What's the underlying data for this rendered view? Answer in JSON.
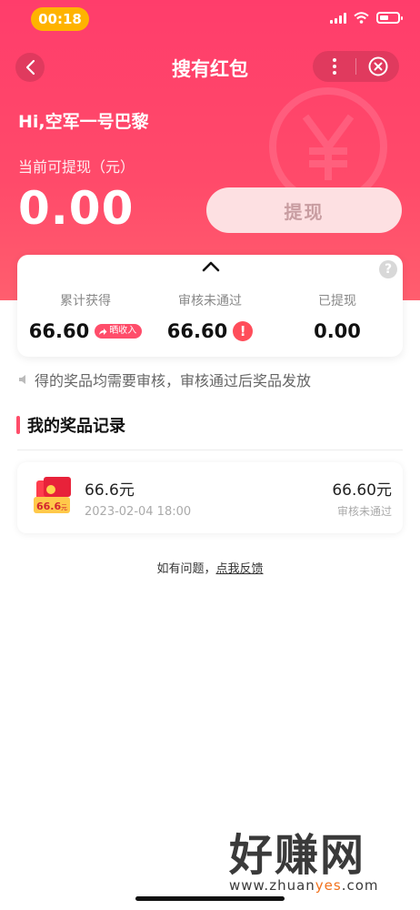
{
  "status_bar": {
    "time": "00:18"
  },
  "nav": {
    "title": "搜有红包"
  },
  "hero": {
    "greeting": "Hi,空军一号巴黎",
    "withdrawable_label": "当前可提现（元）",
    "balance": "0.00",
    "withdraw_button": "提现"
  },
  "stats": {
    "total_earned": {
      "label": "累计获得",
      "value": "66.60",
      "badge": "晒收入"
    },
    "review_failed": {
      "label": "审核未通过",
      "value": "66.60"
    },
    "withdrawn": {
      "label": "已提现",
      "value": "0.00"
    },
    "help_glyph": "?",
    "alert_glyph": "!"
  },
  "notice": {
    "text": "得的奖品均需要审核，审核通过后奖品发放"
  },
  "records_section": {
    "title": "我的奖品记录",
    "items": [
      {
        "name": "66.6元",
        "time": "2023-02-04 18:00",
        "amount": "66.60元",
        "status": "审核未通过",
        "icon_text": "66.6",
        "icon_unit": "元"
      }
    ]
  },
  "feedback": {
    "prefix": "如有问题，",
    "link": "点我反馈"
  },
  "watermark": {
    "title": "好赚网",
    "url_before": "www.zhuan",
    "url_highlight": "yes",
    "url_after": ".com"
  },
  "colors": {
    "brand_red": "#ff3d6b",
    "status_pill": "#ffb300",
    "alert_red": "#ff4d5a"
  },
  "icons": [
    "back-arrow-icon",
    "more-icon",
    "close-circle-icon",
    "yen-icon",
    "chevron-up-icon",
    "help-icon",
    "share-icon",
    "alert-icon",
    "speaker-icon",
    "red-envelope-icon"
  ]
}
